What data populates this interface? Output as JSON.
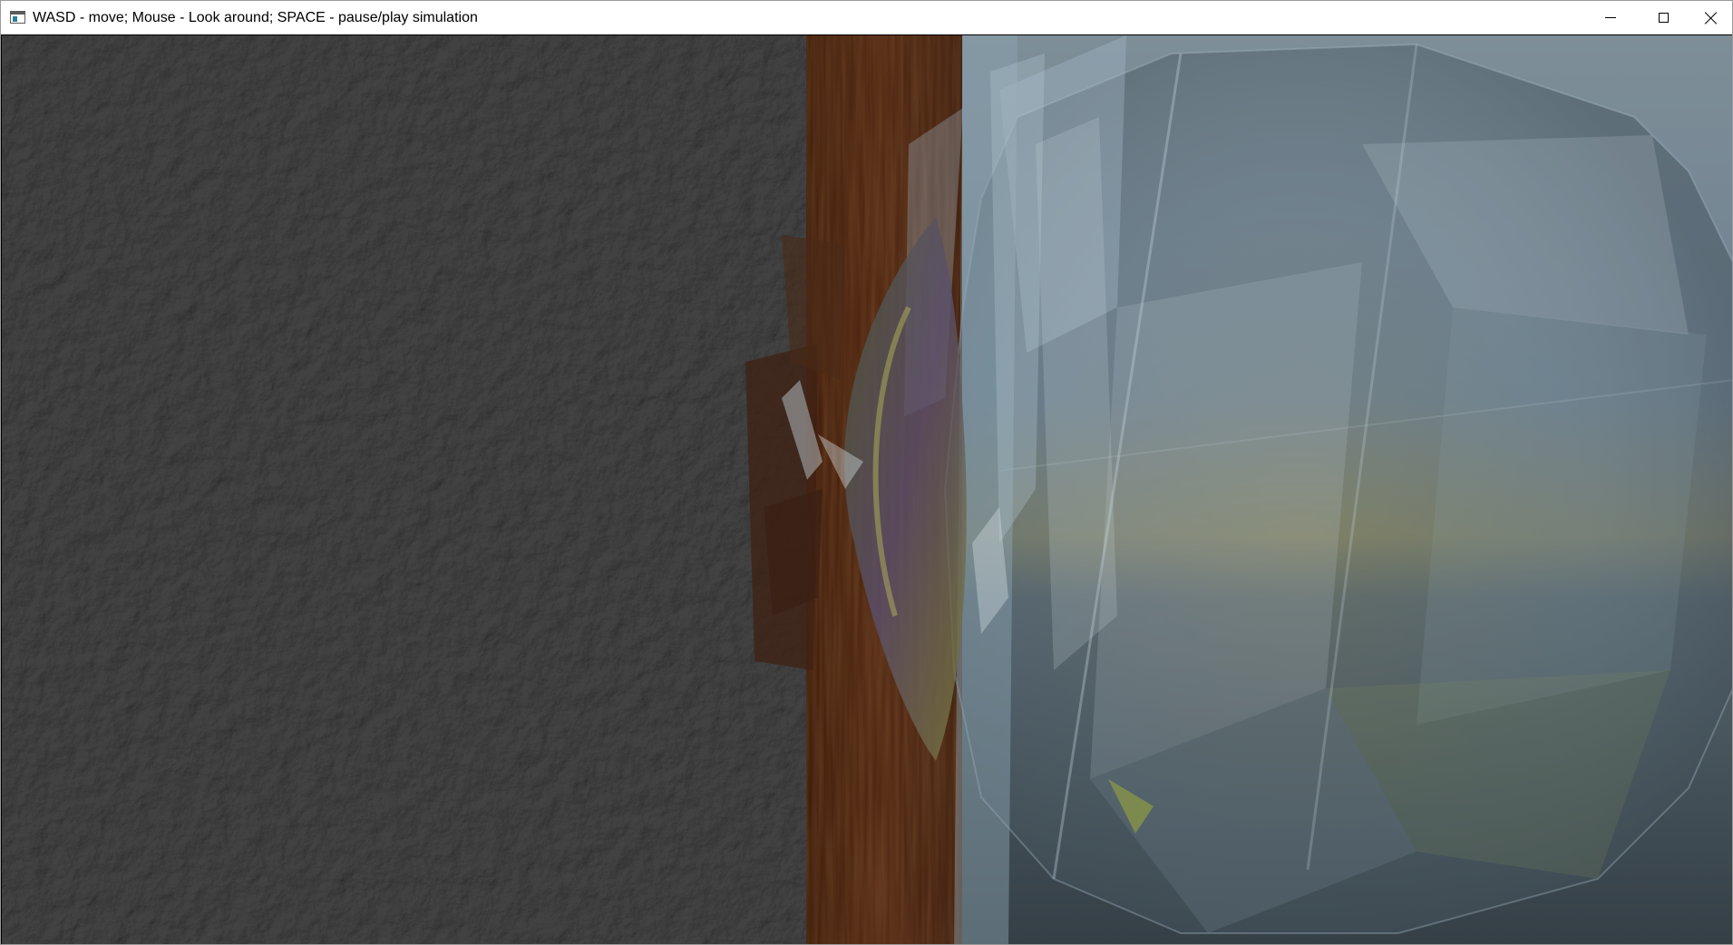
{
  "window": {
    "title": "WASD - move; Mouse - Look around; SPACE - pause/play simulation",
    "icon": "app-window-icon",
    "controls": {
      "minimize_icon": "minimize-icon",
      "maximize_icon": "maximize-icon",
      "close_icon": "close-icon"
    }
  },
  "scene": {
    "colors": {
      "wall": "#2b2b2b",
      "wood": "#4a2410",
      "sky": "#6a7b86",
      "sea": "#3c4a52",
      "glass": "#9fb6c4"
    }
  }
}
